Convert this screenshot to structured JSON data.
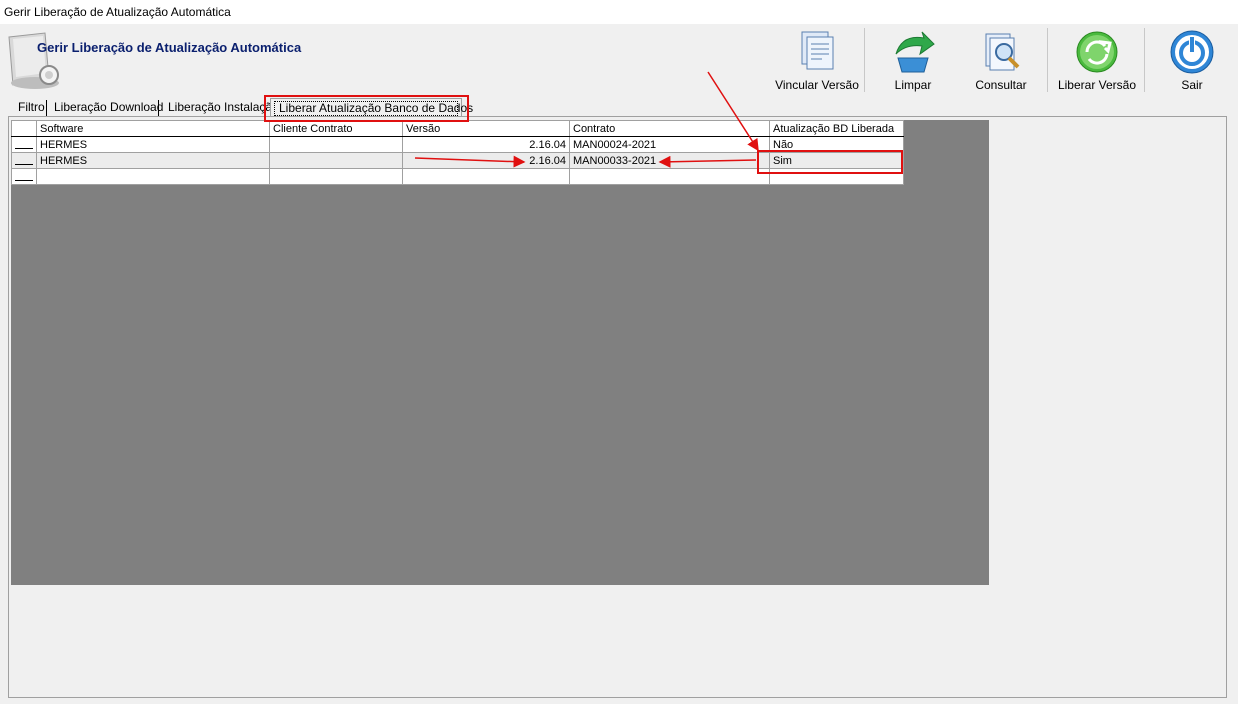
{
  "window": {
    "title": "Gerir Liberação de Atualização Automática"
  },
  "header": {
    "title": "Gerir Liberação de Atualização Automática",
    "icon": "app-screen-icon"
  },
  "toolbar": {
    "vincular_label": "Vincular Versão",
    "limpar_label": "Limpar",
    "consultar_label": "Consultar",
    "liberar_label": "Liberar Versão",
    "sair_label": "Sair"
  },
  "tabs": [
    {
      "label": "Filtro"
    },
    {
      "label": "Liberação Download"
    },
    {
      "label": "Liberação Instalação"
    },
    {
      "label": "Liberar Atualização Banco de Dados"
    }
  ],
  "grid": {
    "columns": [
      "Software",
      "Cliente Contrato",
      "Versão",
      "Contrato",
      "Atualização BD Liberada"
    ],
    "rows": [
      {
        "software": "HERMES",
        "cliente": "",
        "versao": "2.16.04",
        "contrato": "MAN00024-2021",
        "liberada": "Não"
      },
      {
        "software": "HERMES",
        "cliente": "",
        "versao": "2.16.04",
        "contrato": "MAN00033-2021",
        "liberada": "Sim"
      },
      {
        "software": "",
        "cliente": "",
        "versao": "",
        "contrato": "",
        "liberada": ""
      }
    ]
  },
  "colors": {
    "annotation": "#e01010",
    "grid_bg": "#808080",
    "header_title": "#0a1f6e"
  }
}
